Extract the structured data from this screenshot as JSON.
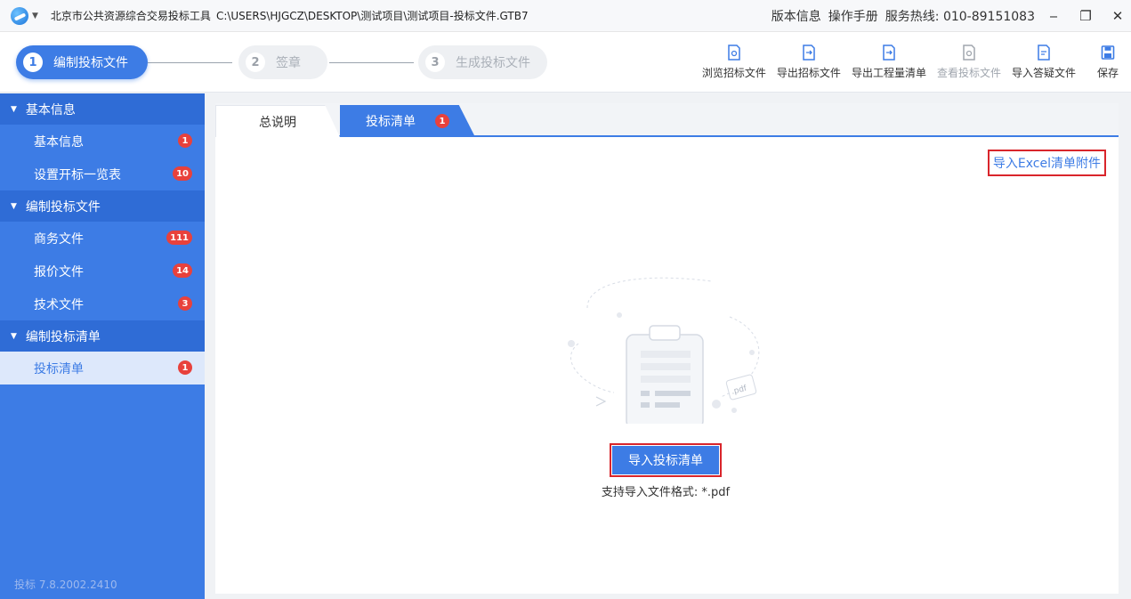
{
  "titlebar": {
    "app_name": "北京市公共资源综合交易投标工具",
    "file_path": "C:\\USERS\\HJGCZ\\DESKTOP\\测试项目\\测试项目-投标文件.GTB7",
    "version_info": "版本信息",
    "manual": "操作手册",
    "hotline": "服务热线: 010-89151083"
  },
  "steps": [
    {
      "num": "1",
      "label": "编制投标文件"
    },
    {
      "num": "2",
      "label": "签章"
    },
    {
      "num": "3",
      "label": "生成投标文件"
    }
  ],
  "toolbar": {
    "browse": "浏览招标文件",
    "export_tender": "导出招标文件",
    "export_bill": "导出工程量清单",
    "view_bid": "查看投标文件",
    "import_qa": "导入答疑文件",
    "save": "保存"
  },
  "sidebar": {
    "groups": [
      {
        "label": "基本信息",
        "items": [
          {
            "label": "基本信息",
            "badge": "1"
          },
          {
            "label": "设置开标一览表",
            "badge": "10"
          }
        ]
      },
      {
        "label": "编制投标文件",
        "items": [
          {
            "label": "商务文件",
            "badge": "111"
          },
          {
            "label": "报价文件",
            "badge": "14"
          },
          {
            "label": "技术文件",
            "badge": "3"
          }
        ]
      },
      {
        "label": "编制投标清单",
        "items": [
          {
            "label": "投标清单",
            "badge": "1"
          }
        ]
      }
    ],
    "version": "投标  7.8.2002.2410"
  },
  "tabs": [
    {
      "label": "总说明"
    },
    {
      "label": "投标清单",
      "badge": "1"
    }
  ],
  "main": {
    "import_excel": "导入Excel清单附件",
    "import_bid_list": "导入投标清单",
    "format_note": "支持导入文件格式: *.pdf",
    "pdf_tag": ".pdf"
  },
  "colors": {
    "accent": "#3d7ce5",
    "badge": "#e8413c",
    "highlight_border": "#d9252b"
  }
}
